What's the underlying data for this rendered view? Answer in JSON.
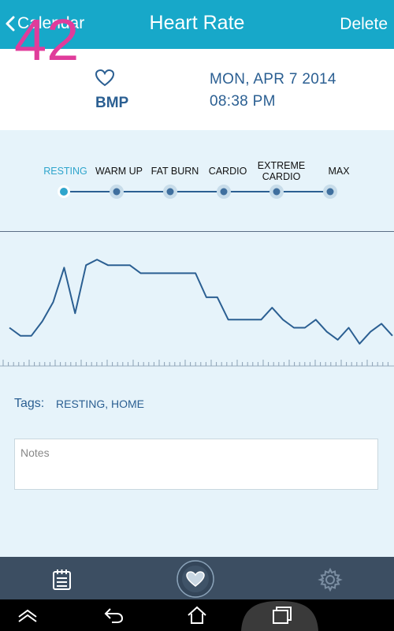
{
  "header": {
    "back_label": "Calendar",
    "title": "Heart Rate",
    "delete_label": "Delete"
  },
  "summary": {
    "bpm_value": "42",
    "bpm_unit": "BMP",
    "date": "MON, APR 7 2014",
    "time": "08:38 PM"
  },
  "zones": [
    {
      "label": "RESTING",
      "active": true
    },
    {
      "label": "WARM UP",
      "active": false
    },
    {
      "label": "FAT BURN",
      "active": false
    },
    {
      "label": "CARDIO",
      "active": false
    },
    {
      "label": "EXTREME\nCARDIO",
      "active": false
    },
    {
      "label": "MAX",
      "active": false
    }
  ],
  "chart_data": {
    "type": "line",
    "series": [
      {
        "values": [
          30,
          20,
          20,
          38,
          62,
          105,
          48,
          108,
          115,
          108,
          108,
          108,
          98,
          98,
          98,
          98,
          98,
          98,
          68,
          68,
          40,
          40,
          40,
          40,
          55,
          40,
          30,
          30,
          40,
          25,
          15,
          30,
          10,
          25,
          35,
          20
        ]
      }
    ],
    "colors": {
      "line": "#2b5f92"
    }
  },
  "tags": {
    "label": "Tags:",
    "value": "RESTING, HOME"
  },
  "notes": {
    "placeholder": "Notes"
  },
  "bottom_nav": {
    "items": [
      "calendar-icon",
      "heart-icon",
      "gear-icon"
    ]
  },
  "colors": {
    "header": "#17a8c9",
    "accent_pink": "#e03c9b",
    "text_blue": "#2b5f92",
    "background": "#e6f3fa",
    "bottom_bar": "#3c4e62"
  }
}
